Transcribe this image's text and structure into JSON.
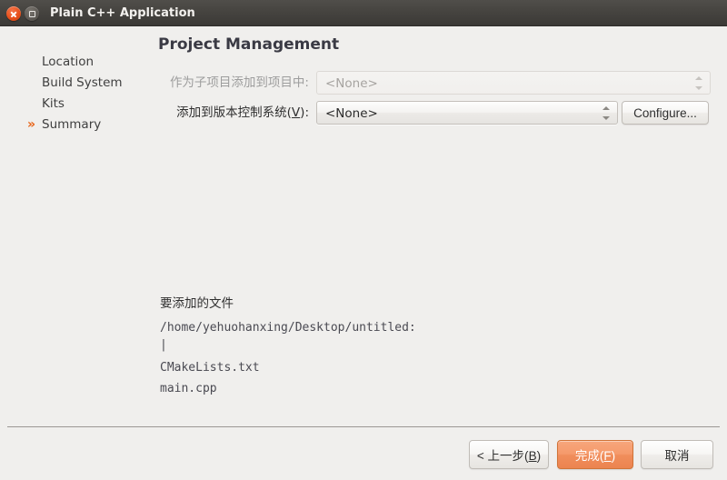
{
  "window": {
    "title": "Plain C++ Application",
    "close_icon": "close-icon",
    "maximize_icon": "maximize-icon"
  },
  "sidebar": {
    "items": [
      {
        "label": "Location",
        "current": false,
        "marker": ""
      },
      {
        "label": "Build System",
        "current": false,
        "marker": ""
      },
      {
        "label": "Kits",
        "current": false,
        "marker": ""
      },
      {
        "label": "Summary",
        "current": true,
        "marker": "»"
      }
    ]
  },
  "main": {
    "heading": "Project Management",
    "fields": [
      {
        "label": "作为子项目添加到项目中:",
        "value": "<None>",
        "enabled": false
      },
      {
        "label_pre": "添加到版本控制系统(",
        "label_key": "V",
        "label_post": "):",
        "value": "<None>",
        "enabled": true
      }
    ],
    "configure_button": "Configure...",
    "files_title": "要添加的文件",
    "files": [
      "/home/yehuohanxing/Desktop/untitled:",
      "|",
      "CMakeLists.txt",
      "main.cpp"
    ]
  },
  "footer": {
    "back_pre": "< 上一步(",
    "back_key": "B",
    "back_post": ")",
    "finish_pre": "完成(",
    "finish_key": "F",
    "finish_post": ")",
    "cancel": "取消"
  },
  "colors": {
    "accent": "#e8661b",
    "default_button": "#f0905e",
    "titlebar": "#46443f",
    "window_bg": "#f0efed"
  }
}
